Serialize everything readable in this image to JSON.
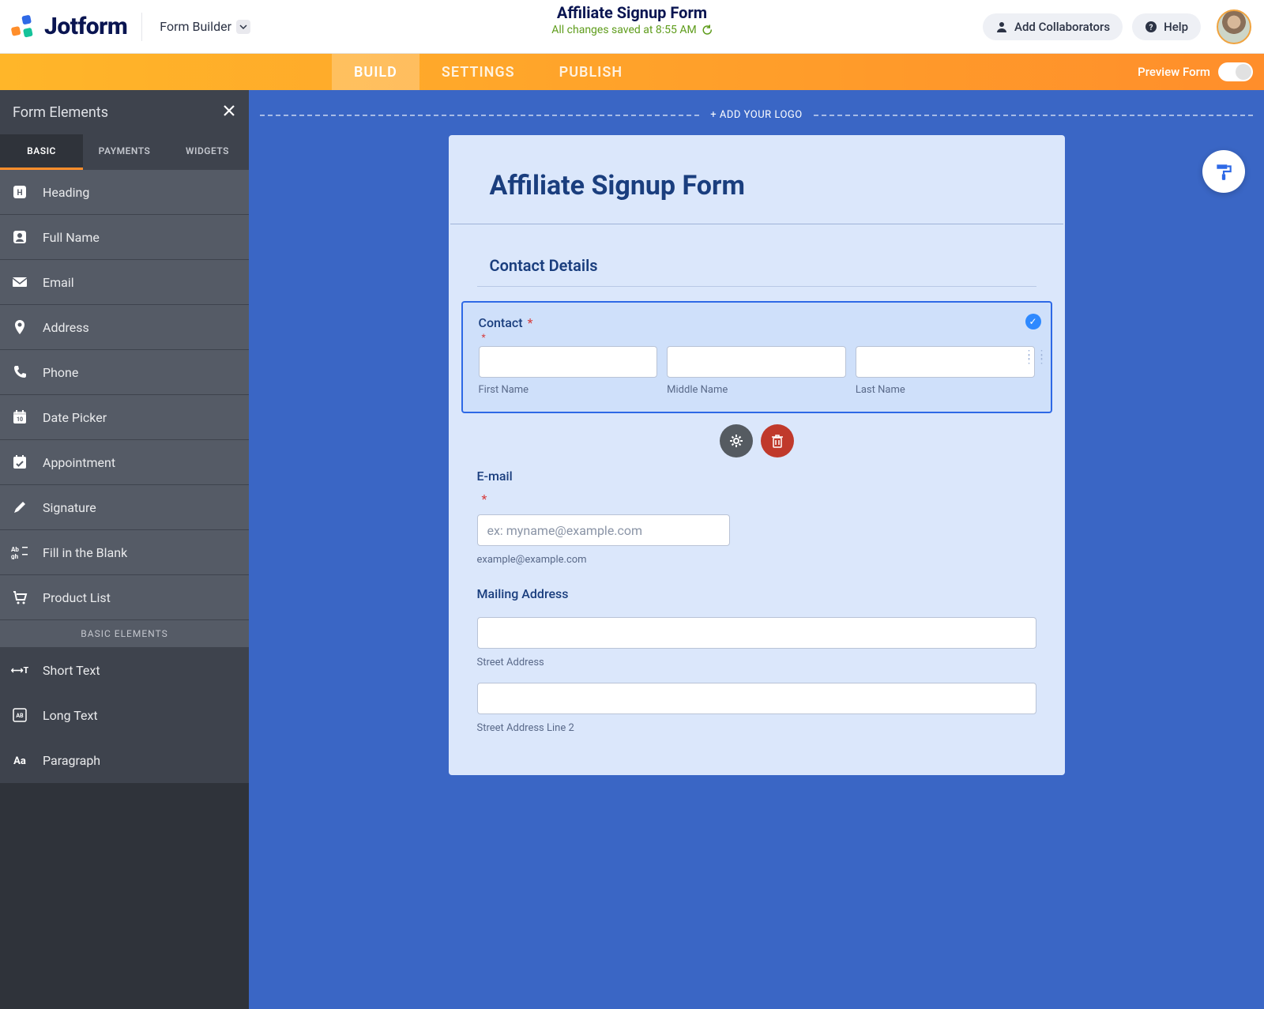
{
  "brand": "Jotform",
  "header": {
    "form_builder": "Form Builder",
    "title": "Affiliate Signup Form",
    "saved_status": "All changes saved at 8:55 AM",
    "add_collaborators": "Add Collaborators",
    "help": "Help"
  },
  "tabs": {
    "build": "BUILD",
    "settings": "SETTINGS",
    "publish": "PUBLISH",
    "preview": "Preview Form"
  },
  "sidebar": {
    "title": "Form Elements",
    "tabs": {
      "basic": "BASIC",
      "payments": "PAYMENTS",
      "widgets": "WIDGETS"
    },
    "items": {
      "heading": "Heading",
      "full_name": "Full Name",
      "email": "Email",
      "address": "Address",
      "phone": "Phone",
      "date_picker": "Date Picker",
      "appointment": "Appointment",
      "signature": "Signature",
      "fill_blank": "Fill in the Blank",
      "product_list": "Product List",
      "section": "BASIC ELEMENTS",
      "short_text": "Short Text",
      "long_text": "Long Text",
      "paragraph": "Paragraph"
    }
  },
  "canvas": {
    "add_logo": "+ ADD YOUR LOGO",
    "form_title": "Affiliate Signup Form",
    "section_contact": "Contact Details",
    "contact": {
      "label": "Contact",
      "first": "First Name",
      "middle": "Middle Name",
      "last": "Last Name"
    },
    "email": {
      "label": "E-mail",
      "placeholder": "ex: myname@example.com",
      "hint": "example@example.com"
    },
    "mailing": {
      "label": "Mailing Address",
      "street": "Street Address",
      "street2": "Street Address Line 2"
    }
  }
}
